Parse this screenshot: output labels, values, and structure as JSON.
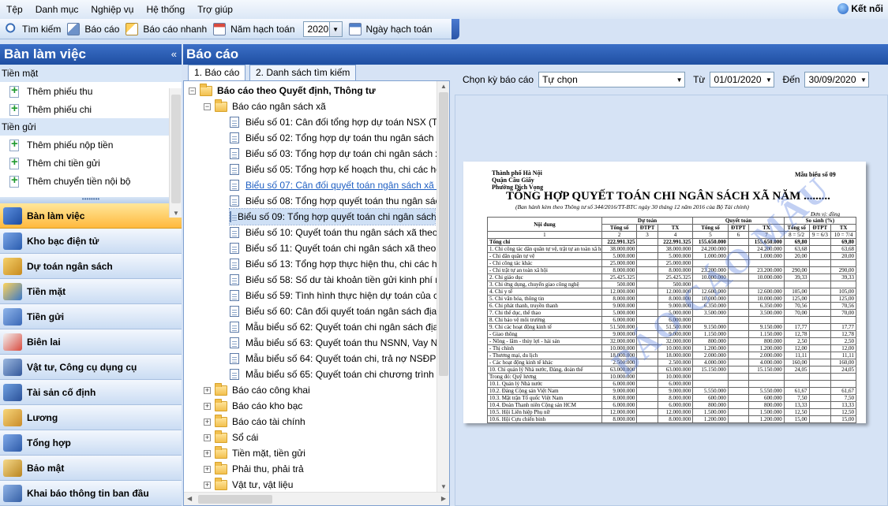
{
  "menubar": {
    "items": [
      "Tệp",
      "Danh mục",
      "Nghiệp vụ",
      "Hệ thống",
      "Trợ giúp"
    ],
    "exit_label": "Kết nối"
  },
  "toolbar": {
    "search": "Tìm kiếm",
    "report": "Báo cáo",
    "quick_report": "Báo cáo nhanh",
    "fiscal_year_label": "Năm hạch toán",
    "fiscal_year": "2020",
    "accounting_date": "Ngày hạch toán"
  },
  "left": {
    "title": "Bàn làm việc",
    "groups": [
      {
        "label": "Tiền mặt",
        "items": [
          "Thêm phiếu thu",
          "Thêm phiếu chi"
        ]
      },
      {
        "label": "Tiền gửi",
        "items": [
          "Thêm phiếu nộp tiền",
          "Thêm chi tiền gửi",
          "Thêm chuyển tiền nội bộ"
        ]
      }
    ],
    "nav": [
      "Bàn làm việc",
      "Kho bạc điện tử",
      "Dự toán ngân sách",
      "Tiền mặt",
      "Tiền gửi",
      "Biên lai",
      "Vật tư, Công cụ dụng cụ",
      "Tài sản cố định",
      "Lương",
      "Tổng hợp",
      "Bảo mật",
      "Khai báo thông tin ban đầu"
    ]
  },
  "main": {
    "title": "Báo cáo",
    "tabs": [
      "1. Báo cáo",
      "2. Danh sách tìm kiếm"
    ],
    "tree": {
      "root": "Báo cáo theo Quyết định, Thông tư",
      "sub": "Báo cáo ngân sách xã",
      "docs": [
        "Biểu số 01: Cân đối tổng hợp dự toán NSX (TT",
        "Biểu số 02: Tổng hợp dự toán thu ngân sách xã",
        "Biểu số 03: Tổng hợp dự toán chi ngân sách xã",
        "Biểu số 05: Tổng hợp kế hoạch thu, chi các ho",
        "Biểu số 07: Cân đối quyết toán ngân sách xã (",
        "Biểu số 08: Tổng hợp quyết toán thu ngân sách",
        "Biểu số 09: Tổng hợp quyết toán chi ngân sách",
        "Biểu số 10: Quyết toán thu ngân sách xã theo",
        "Biểu số 11: Quyết toán chi ngân sách xã theo",
        "Biểu số 13: Tổng hợp thực hiện thu, chi các ho",
        "Biểu số 58: Số dư tài khoản tiền gửi kinh phí ng",
        "Biểu số 59: Tình hình thực hiện dự toán của cá",
        "Biểu số 60: Cân đối quyết toán ngân sách địa p",
        "Mẫu biểu số 62: Quyết toán chi ngân sách địa",
        "Mẫu biểu số 63: Quyết toán thu NSNN, Vay NS",
        "Mẫu biểu số 64: Quyết toán chi, trả nợ NSĐP t",
        "Mẫu biểu số 65: Quyết toán chi chương trình m"
      ],
      "folders": [
        "Báo cáo công khai",
        "Báo cáo kho bạc",
        "Báo cáo tài chính",
        "Sổ cái",
        "Tiền mặt, tiền gửi",
        "Phải thu, phải trả",
        "Vật tư, vật liệu"
      ]
    }
  },
  "filters": {
    "period_label": "Chọn kỳ báo cáo",
    "period_value": "Tự chọn",
    "from_label": "Từ",
    "from_date": "01/01/2020",
    "to_label": "Đến",
    "to_date": "30/09/2020"
  },
  "preview": {
    "city": "Thành phố Hà Nội",
    "district": "Quận Cầu Giấy",
    "ward": "Phường Dịch Vọng",
    "form": "Mẫu biểu số 09",
    "title": "TỔNG HỢP QUYẾT TOÁN CHI NGÂN SÁCH XÃ NĂM .........",
    "subtitle": "(Ban hành kèm theo Thông tư số 344/2016/TT-BTC ngày 30 tháng 12 năm 2016 của Bộ Tài chính)",
    "unit": "Đơn vị: đồng",
    "watermark": "BÁO CÁO MẪU",
    "headers": [
      "Nội dung",
      "Dự toán",
      "Quyết toán",
      "So sánh (%)"
    ],
    "subheaders": [
      "Tổng số",
      "ĐTPT",
      "TX",
      "Tổng số",
      "ĐTPT",
      "TX",
      "Tổng số",
      "ĐTPT",
      "TX"
    ],
    "colnums": [
      "1",
      "2",
      "3",
      "4",
      "5",
      "6",
      "7",
      "8 = 5/2",
      "9 = 6/3",
      "10 = 7/4"
    ],
    "rows": [
      [
        "Tổng chi",
        "222.991.325",
        "",
        "222.991.325",
        "155.650.000",
        "",
        "155.650.000",
        "69,80",
        "",
        "69,80"
      ],
      [
        "1. Chi công tác dân quân tự vệ, trật tự an toàn xã hội",
        "38.000.000",
        "",
        "38.000.000",
        "24.200.000",
        "",
        "24.200.000",
        "63,68",
        "",
        "63,68"
      ],
      [
        "- Chi dân quân tự vệ",
        "5.000.000",
        "",
        "5.000.000",
        "1.000.000",
        "",
        "1.000.000",
        "20,00",
        "",
        "20,00"
      ],
      [
        "- Chi công tác khác",
        "25.000.000",
        "",
        "25.000.000",
        "",
        "",
        "",
        "",
        "",
        ""
      ],
      [
        "- Chi trật tự an toàn xã hội",
        "8.000.000",
        "",
        "8.000.000",
        "23.200.000",
        "",
        "23.200.000",
        "290,00",
        "",
        "290,00"
      ],
      [
        "2. Chi giáo dục",
        "25.425.325",
        "",
        "25.425.325",
        "10.000.000",
        "",
        "10.000.000",
        "39,33",
        "",
        "39,33"
      ],
      [
        "3. Chi ứng dụng, chuyển giao công nghệ",
        "500.000",
        "",
        "500.000",
        "",
        "",
        "",
        "",
        "",
        ""
      ],
      [
        "4. Chi y tế",
        "12.000.000",
        "",
        "12.000.000",
        "12.600.000",
        "",
        "12.600.000",
        "105,00",
        "",
        "105,00"
      ],
      [
        "5. Chi văn hóa, thông tin",
        "8.000.000",
        "",
        "8.000.000",
        "10.000.000",
        "",
        "10.000.000",
        "125,00",
        "",
        "125,00"
      ],
      [
        "6. Chi phát thanh, truyền thanh",
        "9.000.000",
        "",
        "9.000.000",
        "6.350.000",
        "",
        "6.350.000",
        "70,56",
        "",
        "70,56"
      ],
      [
        "7. Chi thể dục, thể thao",
        "5.000.000",
        "",
        "5.000.000",
        "3.500.000",
        "",
        "3.500.000",
        "70,00",
        "",
        "70,00"
      ],
      [
        "8. Chi bảo vệ môi trường",
        "6.000.000",
        "",
        "6.000.000",
        "",
        "",
        "",
        "",
        "",
        ""
      ],
      [
        "9. Chi các hoạt động kinh tế",
        "51.500.000",
        "",
        "51.500.000",
        "9.150.000",
        "",
        "9.150.000",
        "17,77",
        "",
        "17,77"
      ],
      [
        "- Giao thông",
        "9.000.000",
        "",
        "9.000.000",
        "1.150.000",
        "",
        "1.150.000",
        "12,78",
        "",
        "12,78"
      ],
      [
        "- Nông - lâm - thủy lợi - hải sản",
        "32.000.000",
        "",
        "32.000.000",
        "800.000",
        "",
        "800.000",
        "2,50",
        "",
        "2,50"
      ],
      [
        "- Thị chính",
        "10.000.000",
        "",
        "10.000.000",
        "1.200.000",
        "",
        "1.200.000",
        "12,00",
        "",
        "12,00"
      ],
      [
        "- Thương mại, du lịch",
        "18.000.000",
        "",
        "18.000.000",
        "2.000.000",
        "",
        "2.000.000",
        "11,11",
        "",
        "11,11"
      ],
      [
        "- Các hoạt động kinh tế khác",
        "2.500.000",
        "",
        "2.500.000",
        "4.000.000",
        "",
        "4.000.000",
        "160,00",
        "",
        "160,00"
      ],
      [
        "10. Chi quản lý Nhà nước, Đảng, đoàn thể",
        "63.000.000",
        "",
        "63.000.000",
        "15.150.000",
        "",
        "15.150.000",
        "24,05",
        "",
        "24,05"
      ],
      [
        "Trong đó: Quỹ lương",
        "10.000.000",
        "",
        "10.000.000",
        "",
        "",
        "",
        "",
        "",
        ""
      ],
      [
        "10.1. Quản lý Nhà nước",
        "6.000.000",
        "",
        "6.000.000",
        "",
        "",
        "",
        "",
        "",
        ""
      ],
      [
        "10.2. Đảng Cộng sản Việt Nam",
        "9.000.000",
        "",
        "9.000.000",
        "5.550.000",
        "",
        "5.550.000",
        "61,67",
        "",
        "61,67"
      ],
      [
        "10.3. Mặt trận Tổ quốc Việt Nam",
        "8.000.000",
        "",
        "8.000.000",
        "600.000",
        "",
        "600.000",
        "7,50",
        "",
        "7,50"
      ],
      [
        "10.4. Đoàn Thanh niên Cộng sản HCM",
        "6.000.000",
        "",
        "6.000.000",
        "800.000",
        "",
        "800.000",
        "13,33",
        "",
        "13,33"
      ],
      [
        "10.5. Hội Liên hiệp Phụ nữ",
        "12.000.000",
        "",
        "12.000.000",
        "1.500.000",
        "",
        "1.500.000",
        "12,50",
        "",
        "12,50"
      ],
      [
        "10.6. Hội Cựu chiến binh",
        "8.000.000",
        "",
        "8.000.000",
        "1.200.000",
        "",
        "1.200.000",
        "15,00",
        "",
        "15,00"
      ],
      [
        "10.7. Hội Nông dân",
        "10.000.000",
        "",
        "10.000.000",
        "6.000.000",
        "",
        "6.000.000",
        "60,00",
        "",
        "60,00"
      ],
      [
        "11. Chi hỗ trợ khác (nếu có)",
        "6.000.000",
        "",
        "6.000.000",
        "",
        "",
        "",
        "",
        "",
        ""
      ]
    ]
  }
}
